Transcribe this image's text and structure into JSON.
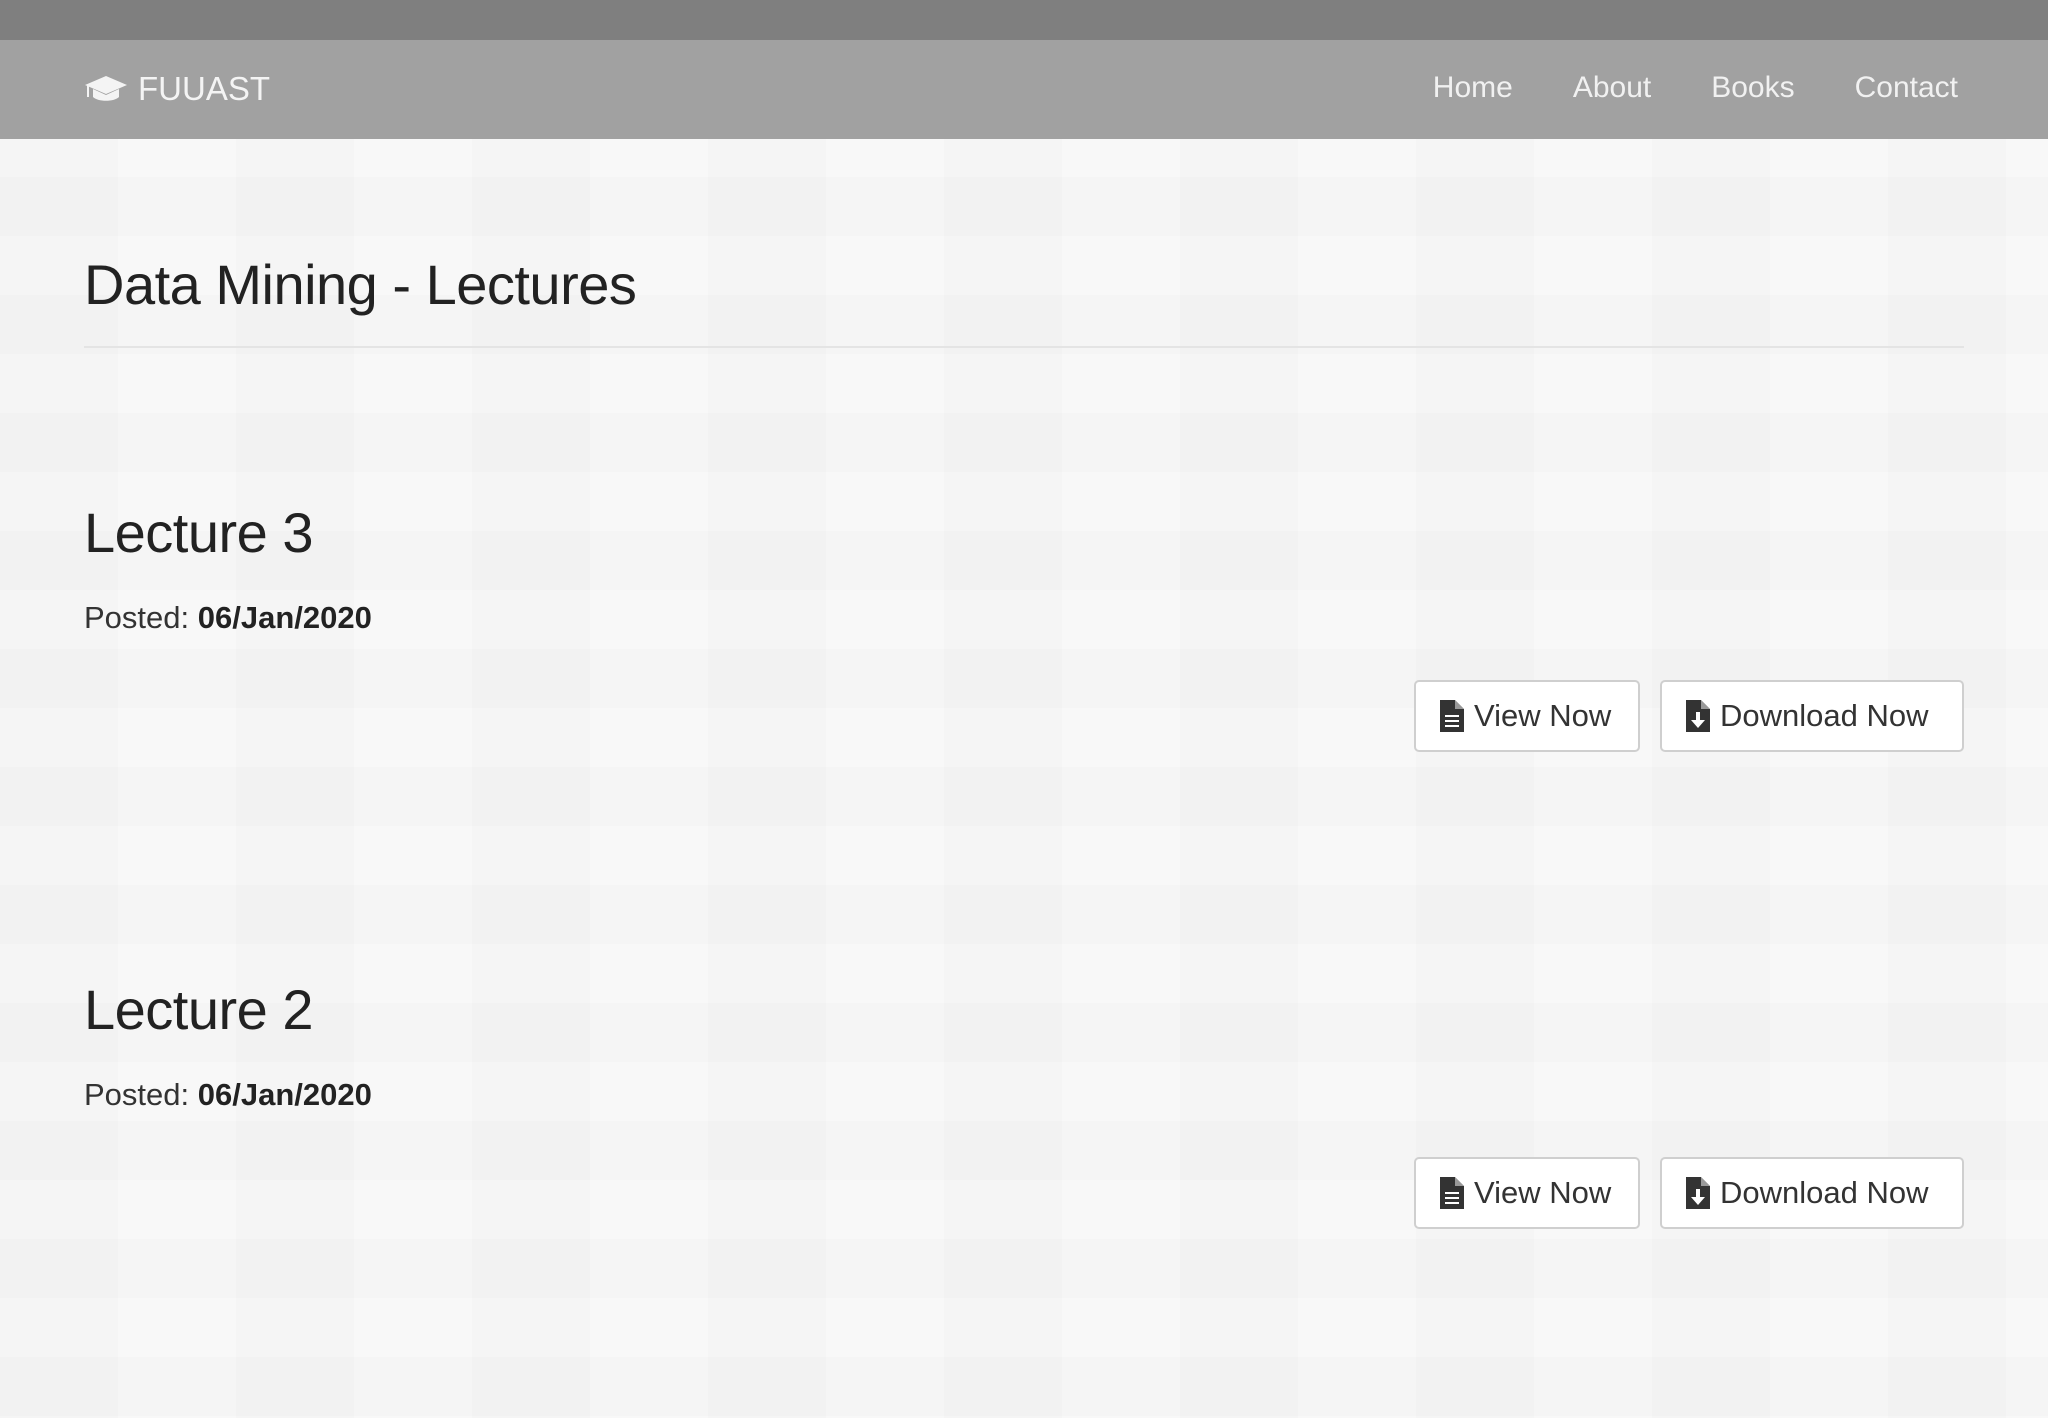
{
  "navbar": {
    "brand": "FUUAST",
    "brand_icon": "graduation-cap-icon",
    "links": [
      "Home",
      "About",
      "Books",
      "Contact"
    ]
  },
  "page": {
    "title": "Data Mining - Lectures"
  },
  "lectures": [
    {
      "title": "Lecture 3",
      "posted_label": "Posted:",
      "posted_date": "06/Jan/2020",
      "view_label": "View Now",
      "download_label": "Download Now"
    },
    {
      "title": "Lecture 2",
      "posted_label": "Posted:",
      "posted_date": "06/Jan/2020",
      "view_label": "View Now",
      "download_label": "Download Now"
    }
  ],
  "icons": {
    "view": "file-text-icon",
    "download": "file-download-icon"
  },
  "colors": {
    "top_strip": "#7f7f7f",
    "navbar": "#a1a1a1",
    "nav_text": "#f1f1f1"
  }
}
